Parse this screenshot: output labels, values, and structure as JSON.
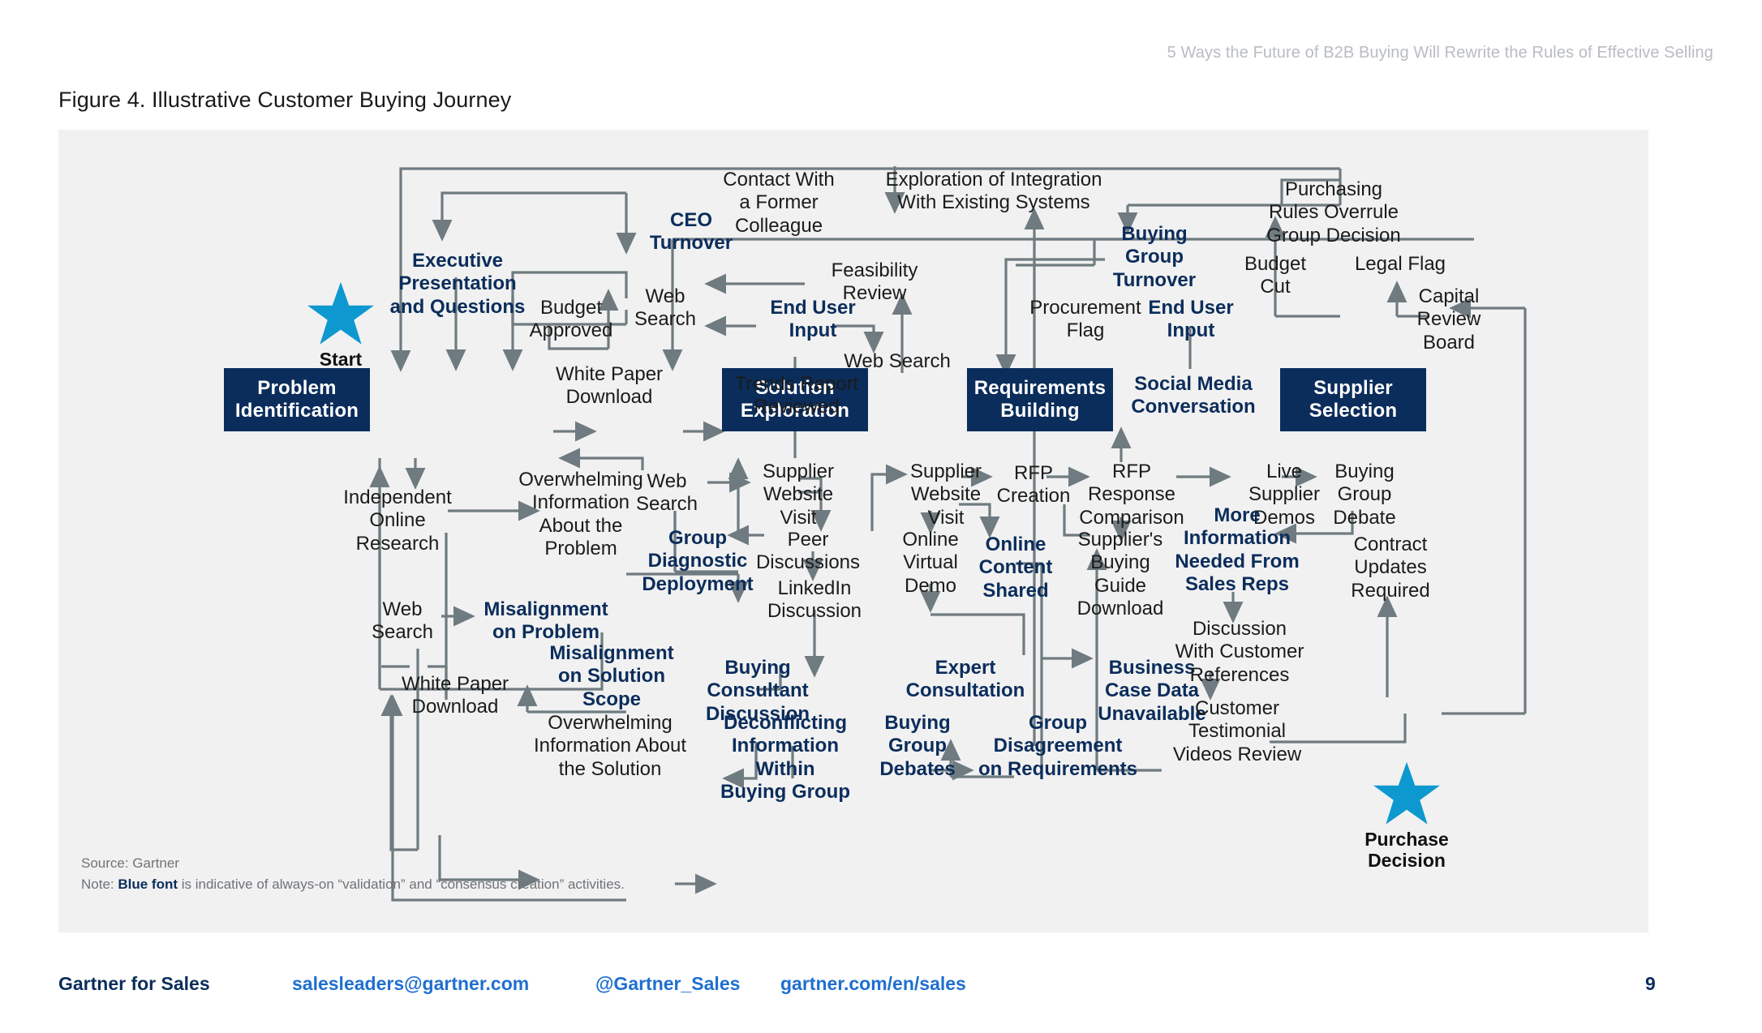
{
  "header": {
    "running_head": "5 Ways the Future of B2B Buying Will Rewrite the Rules of Effective Selling",
    "figure_title": "Figure 4. Illustrative Customer Buying Journey"
  },
  "diagram": {
    "stages": [
      {
        "id": "problem-identification",
        "label": "Problem\nIdentification"
      },
      {
        "id": "solution-exploration",
        "label": "Solution\nExploration"
      },
      {
        "id": "requirements-building",
        "label": "Requirements\nBuilding"
      },
      {
        "id": "supplier-selection",
        "label": "Supplier\nSelection"
      }
    ],
    "markers": [
      {
        "id": "start",
        "label": "Start",
        "color": "#0d98cf"
      },
      {
        "id": "purchase",
        "label": "Purchase\nDecision",
        "color": "#0d98cf"
      }
    ],
    "activities": [
      {
        "id": "ceo-turnover",
        "label": "CEO\nTurnover",
        "kind": "blue"
      },
      {
        "id": "executive-presentation-and-questions",
        "label": "Executive\nPresentation\nand Questions",
        "kind": "blue"
      },
      {
        "id": "budget-approved",
        "label": "Budget\nApproved",
        "kind": "plain"
      },
      {
        "id": "web-search-1",
        "label": "Web\nSearch",
        "kind": "plain"
      },
      {
        "id": "contact-with-a-former-colleague",
        "label": "Contact With\na Former\nColleague",
        "kind": "plain"
      },
      {
        "id": "exploration-of-integration-with-existing-systems",
        "label": "Exploration of Integration\nWith Existing Systems",
        "kind": "plain"
      },
      {
        "id": "buying-group-turnover",
        "label": "Buying\nGroup\nTurnover",
        "kind": "blue"
      },
      {
        "id": "purchasing-rules-overrule-group-decision",
        "label": "Purchasing\nRules Overrule\nGroup Decision",
        "kind": "plain"
      },
      {
        "id": "legal-flag",
        "label": "Legal Flag",
        "kind": "plain"
      },
      {
        "id": "budget-cut",
        "label": "Budget\nCut",
        "kind": "plain"
      },
      {
        "id": "capital-review-board",
        "label": "Capital\nReview\nBoard",
        "kind": "plain"
      },
      {
        "id": "feasibility-review",
        "label": "Feasibility\nReview",
        "kind": "plain"
      },
      {
        "id": "end-user-input-1",
        "label": "End User\nInput",
        "kind": "blue"
      },
      {
        "id": "web-search-2",
        "label": "Web Search",
        "kind": "plain"
      },
      {
        "id": "procurement-flag",
        "label": "Procurement\nFlag",
        "kind": "plain"
      },
      {
        "id": "end-user-input-2",
        "label": "End User\nInput",
        "kind": "blue"
      },
      {
        "id": "white-paper-download-1",
        "label": "White Paper\nDownload",
        "kind": "plain"
      },
      {
        "id": "trends-report-reviewed",
        "label": "Trends Report\nReviewed",
        "kind": "plain"
      },
      {
        "id": "social-media-conversation",
        "label": "Social Media\nConversation",
        "kind": "blue"
      },
      {
        "id": "independent-online-research",
        "label": "Independent\nOnline\nResearch",
        "kind": "plain"
      },
      {
        "id": "overwhelming-information-about-the-problem",
        "label": "Overwhelming\nInformation\nAbout the\nProblem",
        "kind": "plain"
      },
      {
        "id": "web-search-3",
        "label": "Web\nSearch",
        "kind": "plain"
      },
      {
        "id": "supplier-website-visit-1",
        "label": "Supplier\nWebsite\nVisit",
        "kind": "plain"
      },
      {
        "id": "peer-discussions",
        "label": "Peer\nDiscussions",
        "kind": "plain"
      },
      {
        "id": "supplier-website-visit-2",
        "label": "Supplier\nWebsite\nVisit",
        "kind": "plain"
      },
      {
        "id": "rfp-creation",
        "label": "RFP\nCreation",
        "kind": "plain"
      },
      {
        "id": "rfp-response-comparison",
        "label": "RFP\nResponse\nComparison",
        "kind": "plain"
      },
      {
        "id": "live-supplier-demos",
        "label": "Live\nSupplier\nDemos",
        "kind": "plain"
      },
      {
        "id": "buying-group-debate",
        "label": "Buying\nGroup\nDebate",
        "kind": "plain"
      },
      {
        "id": "online-virtual-demo",
        "label": "Online\nVirtual\nDemo",
        "kind": "plain"
      },
      {
        "id": "online-content-shared",
        "label": "Online\nContent\nShared",
        "kind": "blue"
      },
      {
        "id": "suppliers-buying-guide-download",
        "label": "Supplier's\nBuying\nGuide\nDownload",
        "kind": "plain"
      },
      {
        "id": "more-information-needed-from-sales-reps",
        "label": "More\nInformation\nNeeded From\nSales Reps",
        "kind": "blue"
      },
      {
        "id": "contract-updates-required",
        "label": "Contract\nUpdates\nRequired",
        "kind": "plain"
      },
      {
        "id": "web-search-4",
        "label": "Web\nSearch",
        "kind": "plain"
      },
      {
        "id": "misalignment-on-problem",
        "label": "Misalignment\non Problem",
        "kind": "blue"
      },
      {
        "id": "group-diagnostic-deployment",
        "label": "Group\nDiagnostic\nDeployment",
        "kind": "blue"
      },
      {
        "id": "linkedin-discussion",
        "label": "LinkedIn\nDiscussion",
        "kind": "plain"
      },
      {
        "id": "misalignment-on-solution-scope",
        "label": "Misalignment\non Solution\nScope",
        "kind": "blue"
      },
      {
        "id": "buying-consultant-discussion",
        "label": "Buying\nConsultant\nDiscussion",
        "kind": "blue"
      },
      {
        "id": "expert-consultation",
        "label": "Expert\nConsultation",
        "kind": "blue"
      },
      {
        "id": "business-case-data-unavailable",
        "label": "Business\nCase Data\nUnavailable",
        "kind": "blue"
      },
      {
        "id": "discussion-with-customer-references",
        "label": "Discussion\nWith Customer\nReferences",
        "kind": "plain"
      },
      {
        "id": "white-paper-download-2",
        "label": "White Paper\nDownload",
        "kind": "plain"
      },
      {
        "id": "overwhelming-information-about-the-solution",
        "label": "Overwhelming\nInformation About\nthe Solution",
        "kind": "plain"
      },
      {
        "id": "deconflicting-information-within-buying-group",
        "label": "Deconflicting\nInformation\nWithin\nBuying Group",
        "kind": "blue"
      },
      {
        "id": "buying-group-debates",
        "label": "Buying\nGroup\nDebates",
        "kind": "blue"
      },
      {
        "id": "group-disagreement-on-requirements",
        "label": "Group\nDisagreement\non Requirements",
        "kind": "blue"
      },
      {
        "id": "customer-testimonial-videos-review",
        "label": "Customer\nTestimonial\nVideos Review",
        "kind": "plain"
      }
    ],
    "source": "Source: Gartner",
    "note_prefix": "Note: ",
    "note_bold": "Blue font",
    "note_rest": " is indicative of always-on “validation” and “consensus creation” activities."
  },
  "footer": {
    "brand": "Gartner for Sales",
    "email": "salesleaders@gartner.com",
    "twitter": "@Gartner_Sales",
    "website": "gartner.com/en/sales",
    "page": "9"
  },
  "colors": {
    "stage_box": "#0b2d5b",
    "blue_text": "#0b2d5b",
    "star": "#0d98cf",
    "wire": "#6f7b80",
    "panel_bg": "#f1f1f1",
    "link": "#1f6fd0"
  }
}
